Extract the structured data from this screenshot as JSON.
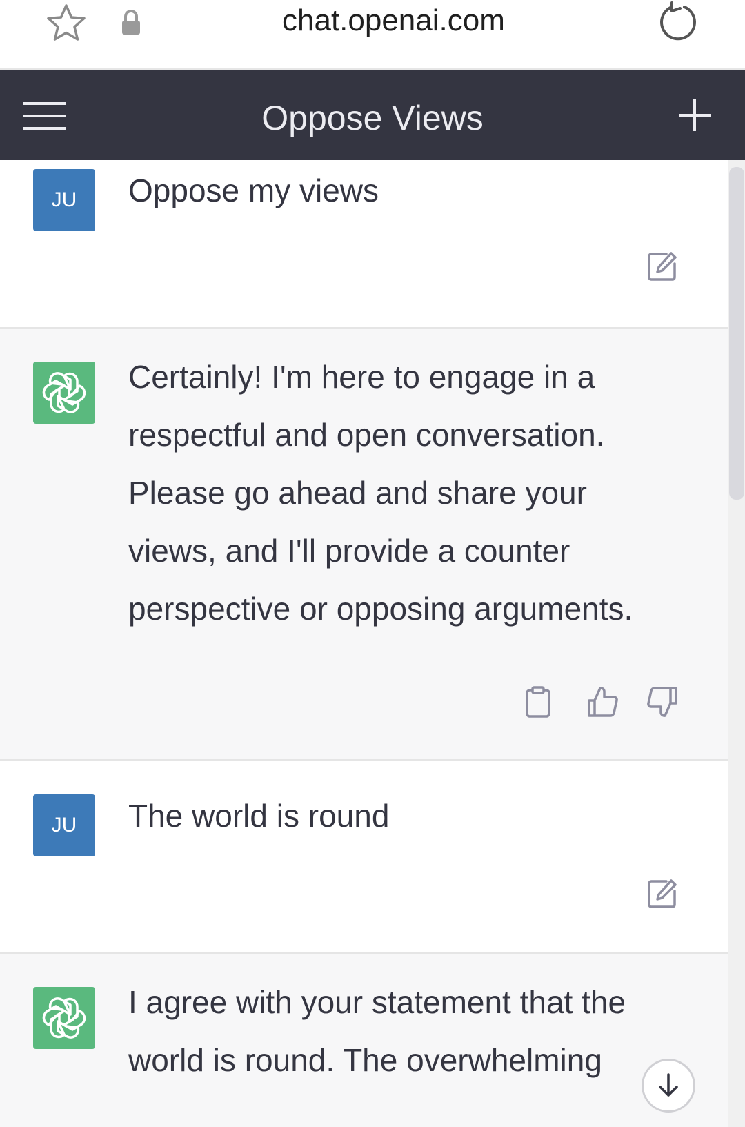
{
  "browser": {
    "url": "chat.openai.com"
  },
  "header": {
    "title": "Oppose Views"
  },
  "messages": [
    {
      "role": "user",
      "avatar_initials": "JU",
      "text": "Oppose my views"
    },
    {
      "role": "assistant",
      "text": "Certainly! I'm here to engage in a respectful and open conversation. Please go ahead and share your views, and I'll provide a counter perspective or opposing arguments."
    },
    {
      "role": "user",
      "avatar_initials": "JU",
      "text": "The world is round"
    },
    {
      "role": "assistant",
      "text": "I agree with your statement that the world is round. The overwhelming"
    }
  ],
  "colors": {
    "header_bg": "#343541",
    "user_avatar": "#3d7ab8",
    "assistant_avatar": "#5ab97e",
    "assistant_bg": "#f7f7f8"
  },
  "icons": {
    "browser": [
      "star-icon",
      "lock-icon",
      "reload-icon"
    ],
    "header": [
      "menu-icon",
      "plus-icon"
    ],
    "user_message": [
      "edit-icon"
    ],
    "assistant_message": [
      "clipboard-icon",
      "thumbs-up-icon",
      "thumbs-down-icon"
    ],
    "scroll": [
      "arrow-down-icon"
    ]
  }
}
